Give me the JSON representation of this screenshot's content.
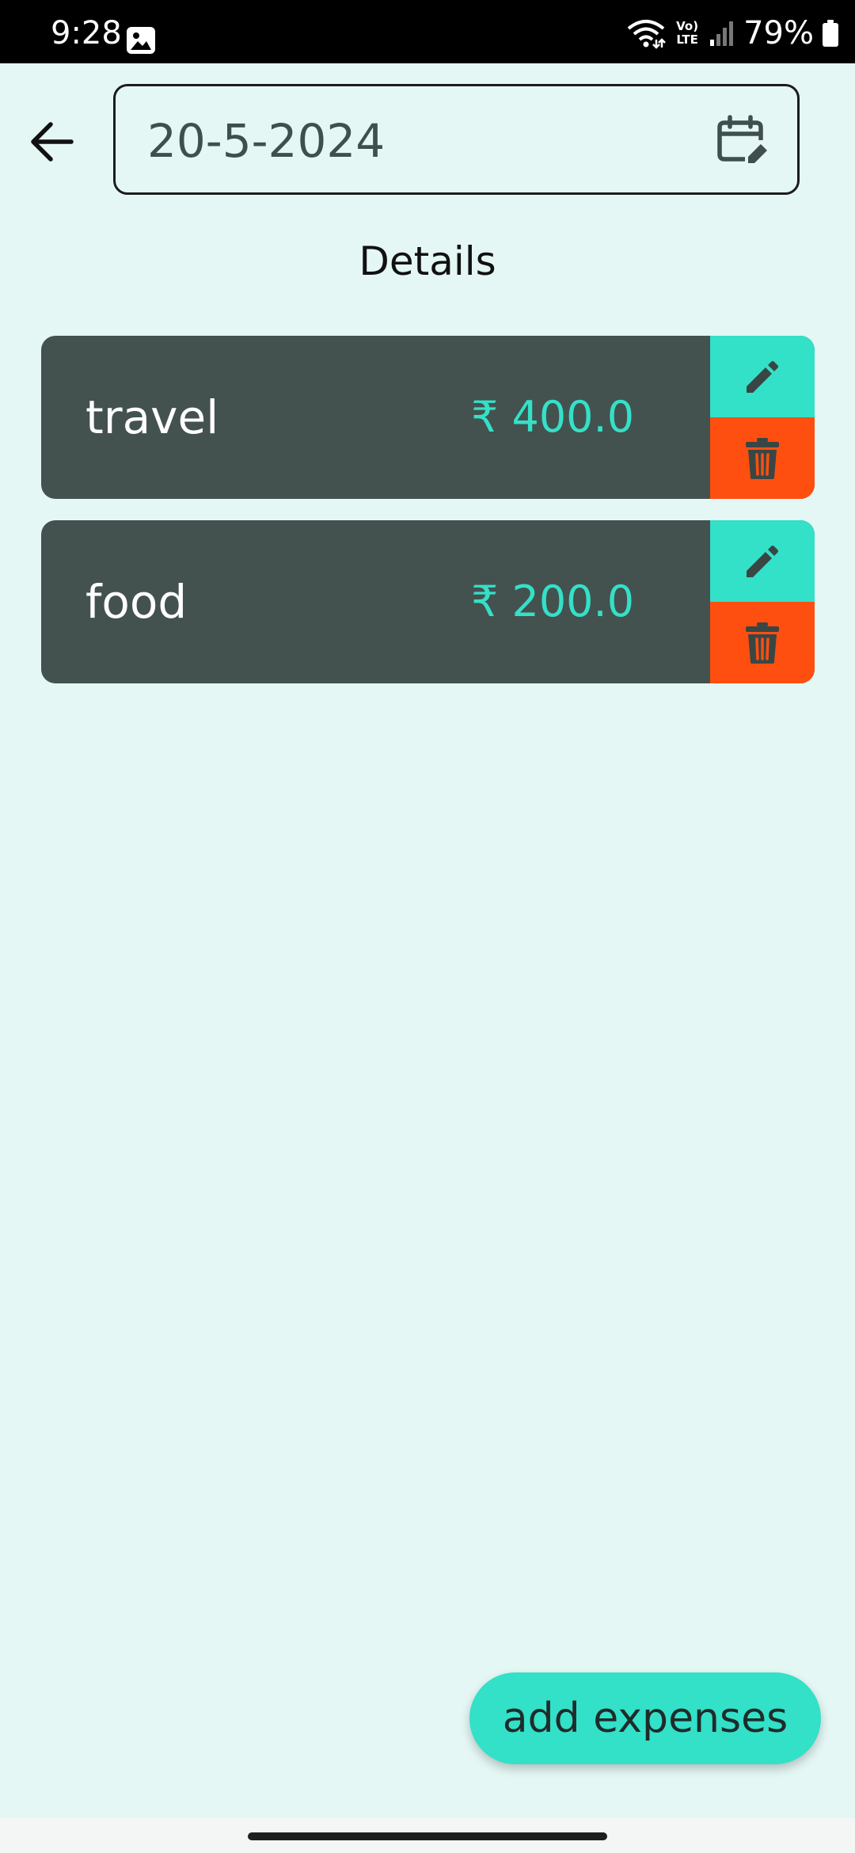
{
  "status_bar": {
    "time": "9:28",
    "network_label": "Vo) LTE",
    "battery": "79%",
    "icons": [
      "gallery-icon",
      "wifi-icon",
      "volte-icon",
      "signal-icon",
      "battery-icon"
    ]
  },
  "header": {
    "back_icon": "arrow-left-icon",
    "date_value": "20-5-2024",
    "calendar_icon": "calendar-edit-icon"
  },
  "page_title": "Details",
  "expenses": [
    {
      "name": "travel",
      "amount": "₹ 400.0"
    },
    {
      "name": "food",
      "amount": "₹ 200.0"
    }
  ],
  "actions": {
    "edit_icon": "pencil-icon",
    "delete_icon": "trash-icon"
  },
  "fab": {
    "label": "add expenses"
  },
  "colors": {
    "background": "#e4f7f4",
    "card": "#43524f",
    "accent": "#33e0c8",
    "delete": "#ff4f10",
    "amount_text": "#35e0c7"
  }
}
